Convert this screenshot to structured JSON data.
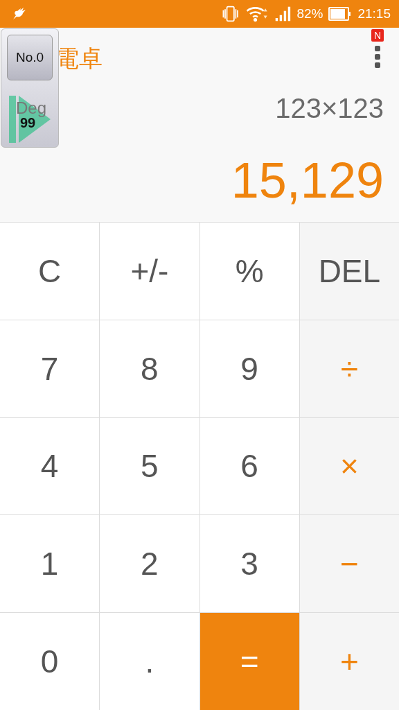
{
  "status_bar": {
    "battery": "82%",
    "time": "21:15"
  },
  "app_bar": {
    "title": "電卓",
    "badge": "N"
  },
  "floating_widget": {
    "counter": "No.0",
    "mode": "Deg",
    "count": "99"
  },
  "display": {
    "expression": "123×123",
    "result": "15,129"
  },
  "keys": [
    {
      "label": "C",
      "kind": "function"
    },
    {
      "label": "+/-",
      "kind": "function"
    },
    {
      "label": "%",
      "kind": "function"
    },
    {
      "label": "DEL",
      "kind": "function"
    },
    {
      "label": "7",
      "kind": "digit"
    },
    {
      "label": "8",
      "kind": "digit"
    },
    {
      "label": "9",
      "kind": "digit"
    },
    {
      "label": "÷",
      "kind": "operator"
    },
    {
      "label": "4",
      "kind": "digit"
    },
    {
      "label": "5",
      "kind": "digit"
    },
    {
      "label": "6",
      "kind": "digit"
    },
    {
      "label": "×",
      "kind": "operator"
    },
    {
      "label": "1",
      "kind": "digit"
    },
    {
      "label": "2",
      "kind": "digit"
    },
    {
      "label": "3",
      "kind": "digit"
    },
    {
      "label": "−",
      "kind": "operator"
    },
    {
      "label": "0",
      "kind": "digit"
    },
    {
      "label": ".",
      "kind": "digit"
    },
    {
      "label": "=",
      "kind": "equals"
    },
    {
      "label": "+",
      "kind": "operator"
    }
  ]
}
